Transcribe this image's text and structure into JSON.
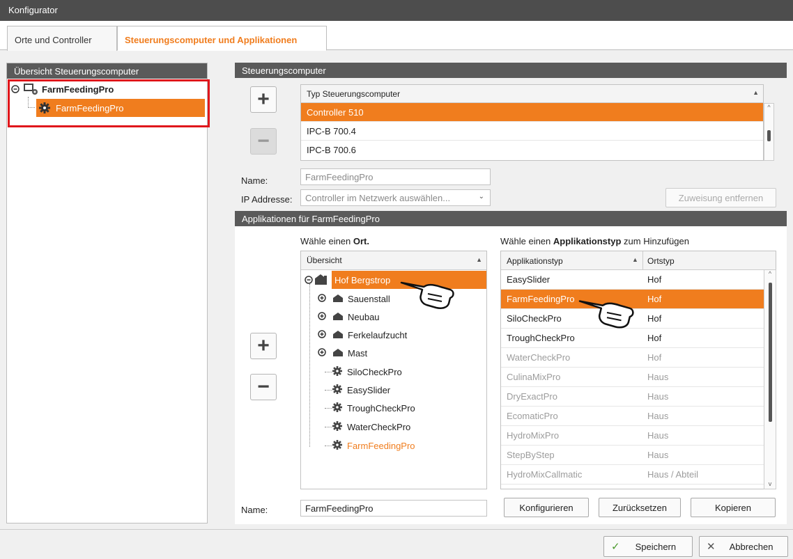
{
  "window": {
    "title": "Konfigurator"
  },
  "tabs": [
    {
      "label": "Orte und Controller"
    },
    {
      "label": "Steuerungscomputer und Applikationen"
    }
  ],
  "left_panel": {
    "header": "Übersicht Steuerungscomputer",
    "root": "FarmFeedingPro",
    "child": "FarmFeedingPro"
  },
  "computer_panel": {
    "header": "Steuerungscomputer",
    "grid_header": "Typ Steuerungscomputer",
    "rows": [
      "Controller 510",
      "IPC-B 700.4",
      "IPC-B 700.6"
    ],
    "name_label": "Name:",
    "name_value": "FarmFeedingPro",
    "ip_label": "IP Addresse:",
    "ip_placeholder": "Controller im Netzwerk auswählen...",
    "remove_assignment": "Zuweisung entfernen"
  },
  "app_panel": {
    "header": "Applikationen für FarmFeedingPro",
    "location_prompt_a": "Wähle einen ",
    "location_prompt_b": "Ort.",
    "type_prompt_a": "Wähle einen ",
    "type_prompt_b": "Applikationstyp",
    "type_prompt_c": " zum Hinzufügen",
    "tree_header": "Übersicht",
    "tree_root": "Hof Bergstrop",
    "tree_nodes": [
      {
        "label": "Sauenstall",
        "kind": "house"
      },
      {
        "label": "Neubau",
        "kind": "house"
      },
      {
        "label": "Ferkelaufzucht",
        "kind": "house"
      },
      {
        "label": "Mast",
        "kind": "house"
      },
      {
        "label": "SiloCheckPro",
        "kind": "app"
      },
      {
        "label": "EasySlider",
        "kind": "app"
      },
      {
        "label": "TroughCheckPro",
        "kind": "app"
      },
      {
        "label": "WaterCheckPro",
        "kind": "app"
      },
      {
        "label": "FarmFeedingPro",
        "kind": "app"
      }
    ],
    "type_col": "Applikationstyp",
    "ort_col": "Ortstyp",
    "types": [
      {
        "name": "EasySlider",
        "ort": "Hof",
        "state": "normal"
      },
      {
        "name": "FarmFeedingPro",
        "ort": "Hof",
        "state": "sel"
      },
      {
        "name": "SiloCheckPro",
        "ort": "Hof",
        "state": "normal"
      },
      {
        "name": "TroughCheckPro",
        "ort": "Hof",
        "state": "normal"
      },
      {
        "name": "WaterCheckPro",
        "ort": "Hof",
        "state": "dim"
      },
      {
        "name": "CulinaMixPro",
        "ort": "Haus",
        "state": "dim"
      },
      {
        "name": "DryExactPro",
        "ort": "Haus",
        "state": "dim"
      },
      {
        "name": "EcomaticPro",
        "ort": "Haus",
        "state": "dim"
      },
      {
        "name": "HydroMixPro",
        "ort": "Haus",
        "state": "dim"
      },
      {
        "name": "StepByStep",
        "ort": "Haus",
        "state": "dim"
      },
      {
        "name": "HydroMixCallmatic",
        "ort": "Haus / Abteil",
        "state": "dim"
      }
    ],
    "name_label": "Name:",
    "name_value": "FarmFeedingPro",
    "configure": "Konfigurieren",
    "reset": "Zurücksetzen",
    "copy": "Kopieren"
  },
  "footer": {
    "save": "Speichern",
    "cancel": "Abbrechen"
  },
  "colors": {
    "accent": "#f07d1e",
    "header": "#5a5a5a",
    "highlight_box": "#e0161b"
  }
}
